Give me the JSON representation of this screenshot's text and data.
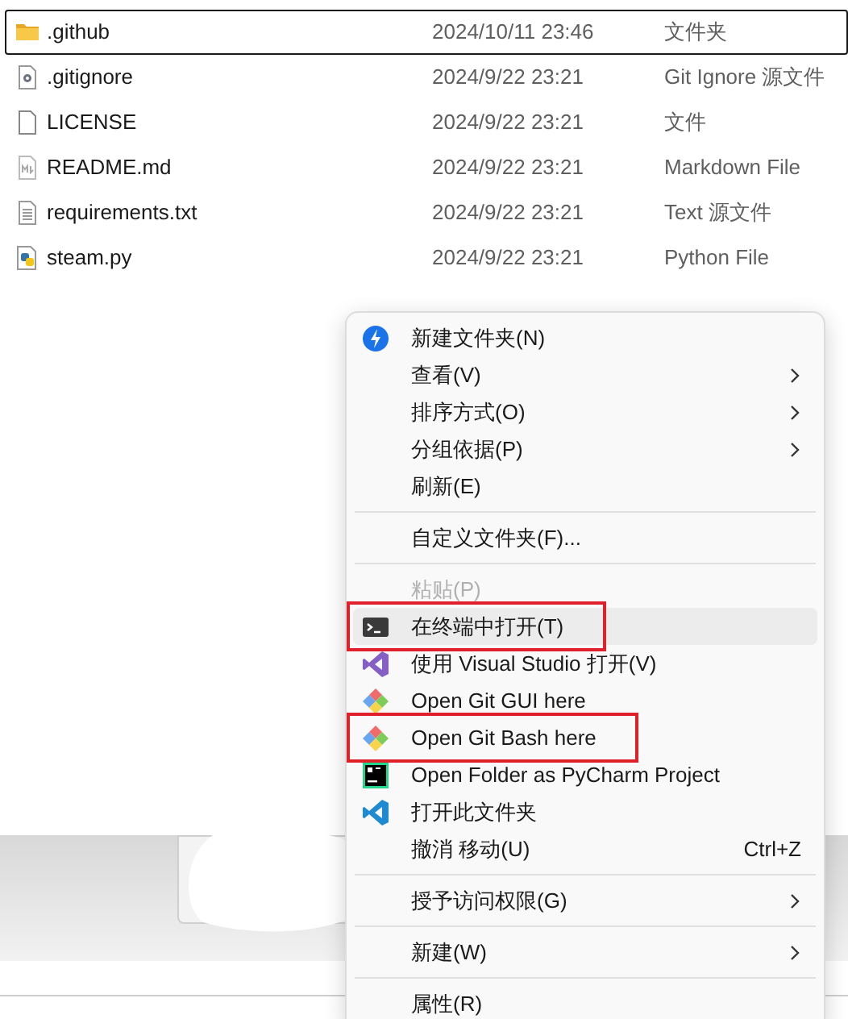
{
  "files": [
    {
      "name": ".github",
      "modified": "2024/10/11 23:46",
      "type": "文件夹",
      "selected": true
    },
    {
      "name": ".gitignore",
      "modified": "2024/9/22 23:21",
      "type": "Git Ignore 源文件",
      "selected": false
    },
    {
      "name": "LICENSE",
      "modified": "2024/9/22 23:21",
      "type": "文件",
      "selected": false
    },
    {
      "name": "README.md",
      "modified": "2024/9/22 23:21",
      "type": "Markdown File",
      "selected": false
    },
    {
      "name": "requirements.txt",
      "modified": "2024/9/22 23:21",
      "type": "Text 源文件",
      "selected": false
    },
    {
      "name": "steam.py",
      "modified": "2024/9/22 23:21",
      "type": "Python File",
      "selected": false
    }
  ],
  "context_menu": [
    {
      "kind": "item",
      "label": "新建文件夹(N)",
      "submenu": false,
      "disabled": false,
      "highlighted": false,
      "annotated": false
    },
    {
      "kind": "item",
      "label": "查看(V)",
      "submenu": true,
      "disabled": false,
      "highlighted": false,
      "annotated": false
    },
    {
      "kind": "item",
      "label": "排序方式(O)",
      "submenu": true,
      "disabled": false,
      "highlighted": false,
      "annotated": false
    },
    {
      "kind": "item",
      "label": "分组依据(P)",
      "submenu": true,
      "disabled": false,
      "highlighted": false,
      "annotated": false
    },
    {
      "kind": "item",
      "label": "刷新(E)",
      "submenu": false,
      "disabled": false,
      "highlighted": false,
      "annotated": false
    },
    {
      "kind": "separator"
    },
    {
      "kind": "item",
      "label": "自定义文件夹(F)...",
      "submenu": false,
      "disabled": false,
      "highlighted": false,
      "annotated": false
    },
    {
      "kind": "separator"
    },
    {
      "kind": "item",
      "label": "粘贴(P)",
      "submenu": false,
      "disabled": true,
      "highlighted": false,
      "annotated": false
    },
    {
      "kind": "item",
      "label": "在终端中打开(T)",
      "submenu": false,
      "disabled": false,
      "highlighted": true,
      "annotated": true
    },
    {
      "kind": "item",
      "label": "使用 Visual Studio 打开(V)",
      "submenu": false,
      "disabled": false,
      "highlighted": false,
      "annotated": false
    },
    {
      "kind": "item",
      "label": "Open Git GUI here",
      "submenu": false,
      "disabled": false,
      "highlighted": false,
      "annotated": false
    },
    {
      "kind": "item",
      "label": "Open Git Bash here",
      "submenu": false,
      "disabled": false,
      "highlighted": false,
      "annotated": true
    },
    {
      "kind": "item",
      "label": "Open Folder as PyCharm Project",
      "submenu": false,
      "disabled": false,
      "highlighted": false,
      "annotated": false
    },
    {
      "kind": "item",
      "label": "打开此文件夹",
      "submenu": false,
      "disabled": false,
      "highlighted": false,
      "annotated": false
    },
    {
      "kind": "item",
      "label": "撤消 移动(U)",
      "shortcut": "Ctrl+Z",
      "submenu": false,
      "disabled": false,
      "highlighted": false,
      "annotated": false
    },
    {
      "kind": "separator"
    },
    {
      "kind": "item",
      "label": "授予访问权限(G)",
      "submenu": true,
      "disabled": false,
      "highlighted": false,
      "annotated": false
    },
    {
      "kind": "separator"
    },
    {
      "kind": "item",
      "label": "新建(W)",
      "submenu": true,
      "disabled": false,
      "highlighted": false,
      "annotated": false
    },
    {
      "kind": "separator"
    },
    {
      "kind": "item",
      "label": "属性(R)",
      "submenu": false,
      "disabled": false,
      "highlighted": false,
      "annotated": false
    }
  ]
}
